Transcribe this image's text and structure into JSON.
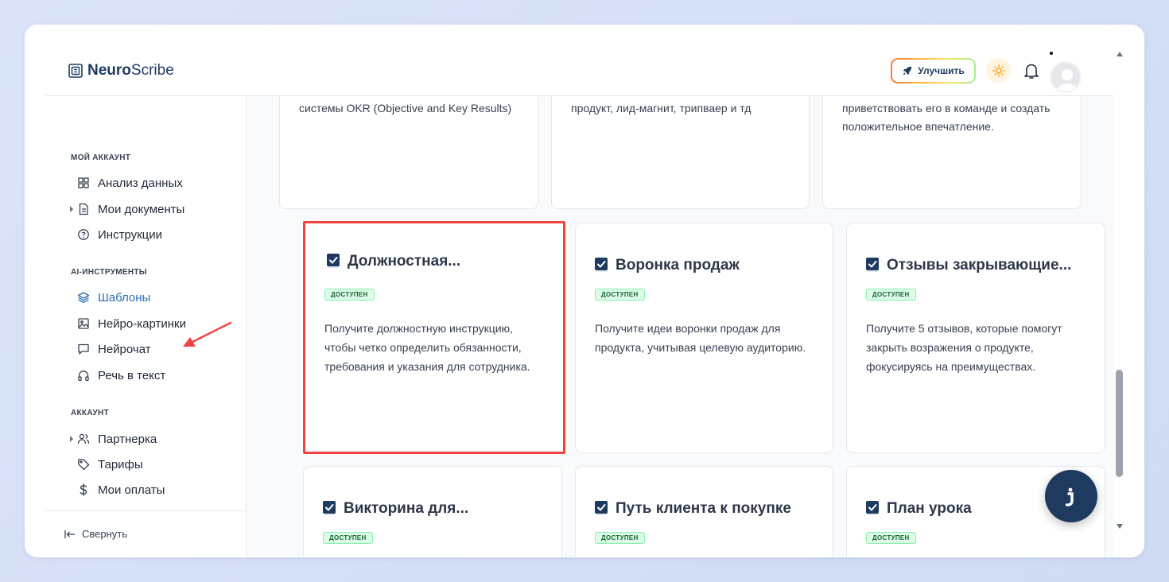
{
  "app": {
    "name_bold": "Neuro",
    "name_light": "Scribe"
  },
  "header": {
    "upgrade_label": "Улучшить"
  },
  "sidebar": {
    "section_account": "МОЙ АККАУНТ",
    "item_analysis": "Анализ данных",
    "item_docs": "Мои документы",
    "item_instructions": "Инструкции",
    "section_ai": "AI-ИНСТРУМЕНТЫ",
    "item_templates": "Шаблоны",
    "item_images": "Нейро-картинки",
    "item_chat": "Нейрочат",
    "item_speech": "Речь в текст",
    "section_acc2": "АККАУНТ",
    "item_partner": "Партнерка",
    "item_tariffs": "Тарифы",
    "item_payments": "Мои оплаты",
    "collapse": "Свернуть"
  },
  "top_cards": [
    {
      "desc": "системы OKR (Objective and Key Results)"
    },
    {
      "desc": "продукт, лид-магнит, трипваер и тд"
    },
    {
      "desc": "приветствовать его в команде и создать положительное впечатление."
    }
  ],
  "cards": [
    {
      "title": "Должностная...",
      "badge": "доступен",
      "desc": "Получите должностную инструкцию, чтобы четко определить обязанности, требования и указания для сотрудника."
    },
    {
      "title": "Воронка продаж",
      "badge": "доступен",
      "desc": "Получите идеи воронки продаж для продукта, учитывая целевую аудиторию."
    },
    {
      "title": "Отзывы закрывающие...",
      "badge": "доступен",
      "desc": "Получите 5 отзывов, которые помогут закрыть возражения о продукте, фокусируясь на преимуществах."
    },
    {
      "title": "Викторина для...",
      "badge": "доступен"
    },
    {
      "title": "Путь клиента к покупке",
      "badge": "доступен"
    },
    {
      "title": "План урока",
      "badge": "доступен"
    }
  ],
  "colors": {
    "brand": "#1e3a5f",
    "accent": "#2b6cb0",
    "highlight": "#ef4444",
    "badge_bg": "#dcfce7"
  }
}
